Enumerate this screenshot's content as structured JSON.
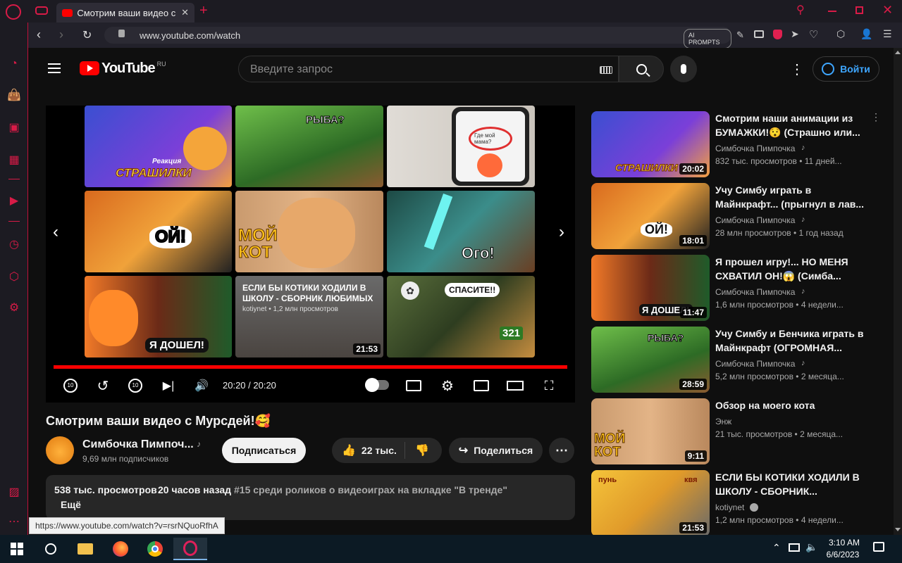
{
  "browser": {
    "tab_title": "Смотрим ваши видео с Му",
    "url": "www.youtube.com/watch",
    "ai_prompts_label": "AI PROMPTS",
    "status_url": "https://www.youtube.com/watch?v=rsrNQuoRfhA"
  },
  "youtube": {
    "logo_text": "YouTube",
    "logo_region": "RU",
    "search_placeholder": "Введите запрос",
    "signin_label": "Войти"
  },
  "player": {
    "time": "20:20 / 20:20",
    "progress": 1.0,
    "end_tiles": [
      {
        "caption": "ЕСЛИ БЫ КОТИКИ ХОДИЛИ В ШКОЛУ - СБОРНИК ЛЮБИМЫХ",
        "meta": "kotiynet • 1,2 млн просмотров",
        "duration": "21:53"
      }
    ],
    "tile_texts": {
      "t1": "СТРАШИЛКИ",
      "t1b": "Реакция",
      "t2": "РЫБА?",
      "t3": "Где мой мама?",
      "t4": "ОЙ!",
      "t5": "МОЙ КОТ",
      "t6": "Ого!",
      "t7": "Я ДОШЕЛ!",
      "t9": "СПАСИТЕ!!",
      "t9b": "321"
    }
  },
  "video": {
    "title": "Смотрим ваши видео с Мурсдей!🥰",
    "channel": "Симбочка Пимпоч...",
    "subscribers": "9,69 млн подписчиков",
    "subscribe_label": "Подписаться",
    "likes": "22 тыс.",
    "share_label": "Поделиться",
    "views": "538 тыс. просмотров",
    "age": "20 часов назад",
    "trend": "#15 среди роликов о видеоиграх на вкладке \"В тренде\"",
    "more_label": "Ещё"
  },
  "recommendations": [
    {
      "title": "Смотрим наши анимации из БУМАЖКИ!😯 (Страшно или...",
      "channel": "Симбочка Пимпочка",
      "meta": "832 тыс. просмотров • 11 дней...",
      "duration": "20:02"
    },
    {
      "title": "Учу Симбу играть в Майнкрафт... (прыгнул в лав...",
      "channel": "Симбочка Пимпочка",
      "meta": "28 млн просмотров • 1 год назад",
      "duration": "18:01"
    },
    {
      "title": "Я прошел игру!... НО МЕНЯ СХВАТИЛ ОН!😱 (Симба...",
      "channel": "Симбочка Пимпочка",
      "meta": "1,6 млн просмотров • 4 недели...",
      "duration": "11:47"
    },
    {
      "title": "Учу Симбу и Бенчика играть в Майнкрафт (ОГРОМНАЯ...",
      "channel": "Симбочка Пимпочка",
      "meta": "5,2 млн просмотров • 2 месяца...",
      "duration": "28:59"
    },
    {
      "title": "Обзор на моего кота",
      "channel": "Энж",
      "meta": "21 тыс. просмотров • 2 месяца...",
      "duration": "9:11"
    },
    {
      "title": "ЕСЛИ БЫ КОТИКИ ХОДИЛИ В ШКОЛУ - СБОРНИК...",
      "channel": "kotiynet",
      "meta": "1,2 млн просмотров • 4 недели...",
      "duration": "21:53"
    }
  ],
  "rec_thumb_texts": {
    "r1": "СТРАШИЛКИ",
    "r2": "ОЙ!",
    "r3": "Я ДОШЕЛ!",
    "r4": "РЫБА?",
    "r5": "МОЙ КОТ",
    "r6a": "пунь",
    "r6b": "квя"
  },
  "taskbar": {
    "time": "3:10 AM",
    "date": "6/6/2023"
  },
  "colors": {
    "opera_red": "#d81b47",
    "yt_red": "#ff0000",
    "signin_blue": "#3ea6ff"
  }
}
